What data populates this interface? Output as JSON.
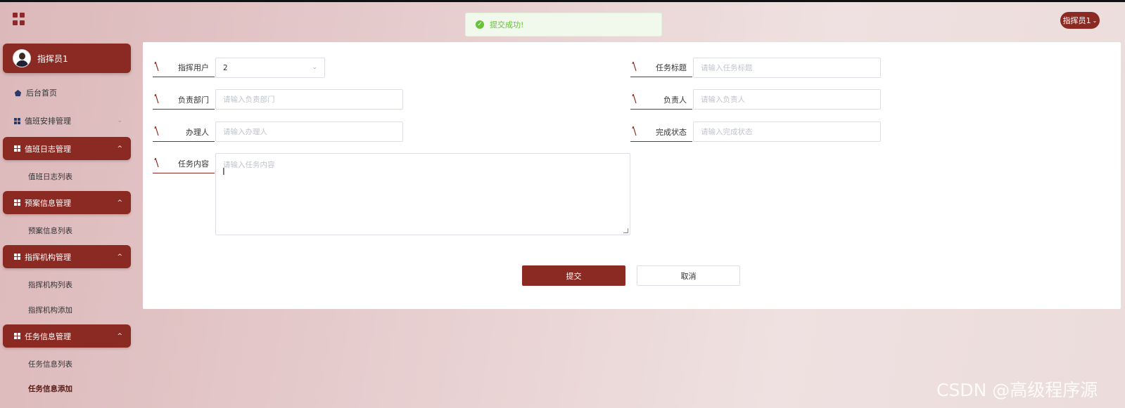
{
  "toast": {
    "message": "提交成功!"
  },
  "header": {
    "user_menu_label": "指挥员1"
  },
  "sidebar": {
    "profile_name": "指挥员1",
    "home": "后台首页",
    "groups": [
      {
        "label": "值班安排管理",
        "expanded": false,
        "items": []
      },
      {
        "label": "值班日志管理",
        "expanded": true,
        "items": [
          "值班日志列表"
        ]
      },
      {
        "label": "预案信息管理",
        "expanded": true,
        "items": [
          "预案信息列表"
        ]
      },
      {
        "label": "指挥机构管理",
        "expanded": true,
        "items": [
          "指挥机构列表",
          "指挥机构添加"
        ]
      },
      {
        "label": "任务信息管理",
        "expanded": true,
        "items": [
          "任务信息列表",
          "任务信息添加"
        ]
      }
    ]
  },
  "form": {
    "commander_user": {
      "label": "指挥用户",
      "value": "2"
    },
    "task_title": {
      "label": "任务标题",
      "placeholder": "请输入任务标题"
    },
    "department": {
      "label": "负责部门",
      "placeholder": "请输入负责部门"
    },
    "person_in_charge": {
      "label": "负责人",
      "placeholder": "请输入负责人"
    },
    "handler": {
      "label": "办理人",
      "placeholder": "请输入办理人"
    },
    "status": {
      "label": "完成状态",
      "placeholder": "请输入完成状态"
    },
    "content": {
      "label": "任务内容",
      "placeholder": "请输入任务内容"
    },
    "submit_label": "提交",
    "cancel_label": "取消"
  },
  "watermark": "CSDN @高级程序源",
  "colors": {
    "primary": "#8b2a23",
    "success": "#67c23a"
  }
}
